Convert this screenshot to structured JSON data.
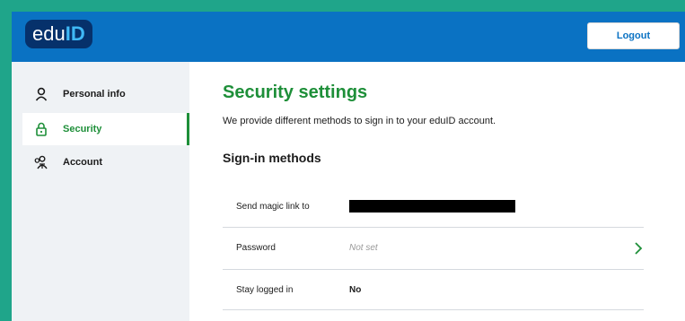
{
  "header": {
    "logo_part1": "edu",
    "logo_part2": "ID",
    "logout_label": "Logout"
  },
  "sidebar": {
    "items": [
      {
        "label": "Personal info",
        "icon": "person-icon",
        "active": false
      },
      {
        "label": "Security",
        "icon": "lock-icon",
        "active": true
      },
      {
        "label": "Account",
        "icon": "account-icon",
        "active": false
      }
    ]
  },
  "main": {
    "title": "Security settings",
    "subtitle": "We provide different methods to sign in to your eduID account.",
    "section_title": "Sign-in methods",
    "rows": [
      {
        "label": "Send magic link to",
        "value": "",
        "redacted": true
      },
      {
        "label": "Password",
        "value": "Not set",
        "action_icon": "chevron-right-icon"
      },
      {
        "label": "Stay logged in",
        "value": "No"
      }
    ]
  },
  "colors": {
    "outer_border": "#1fa58a",
    "header": "#0a72c3",
    "logo_bg": "#06316b",
    "accent_green": "#1e8f39",
    "sidebar_bg": "#eff2f5"
  }
}
